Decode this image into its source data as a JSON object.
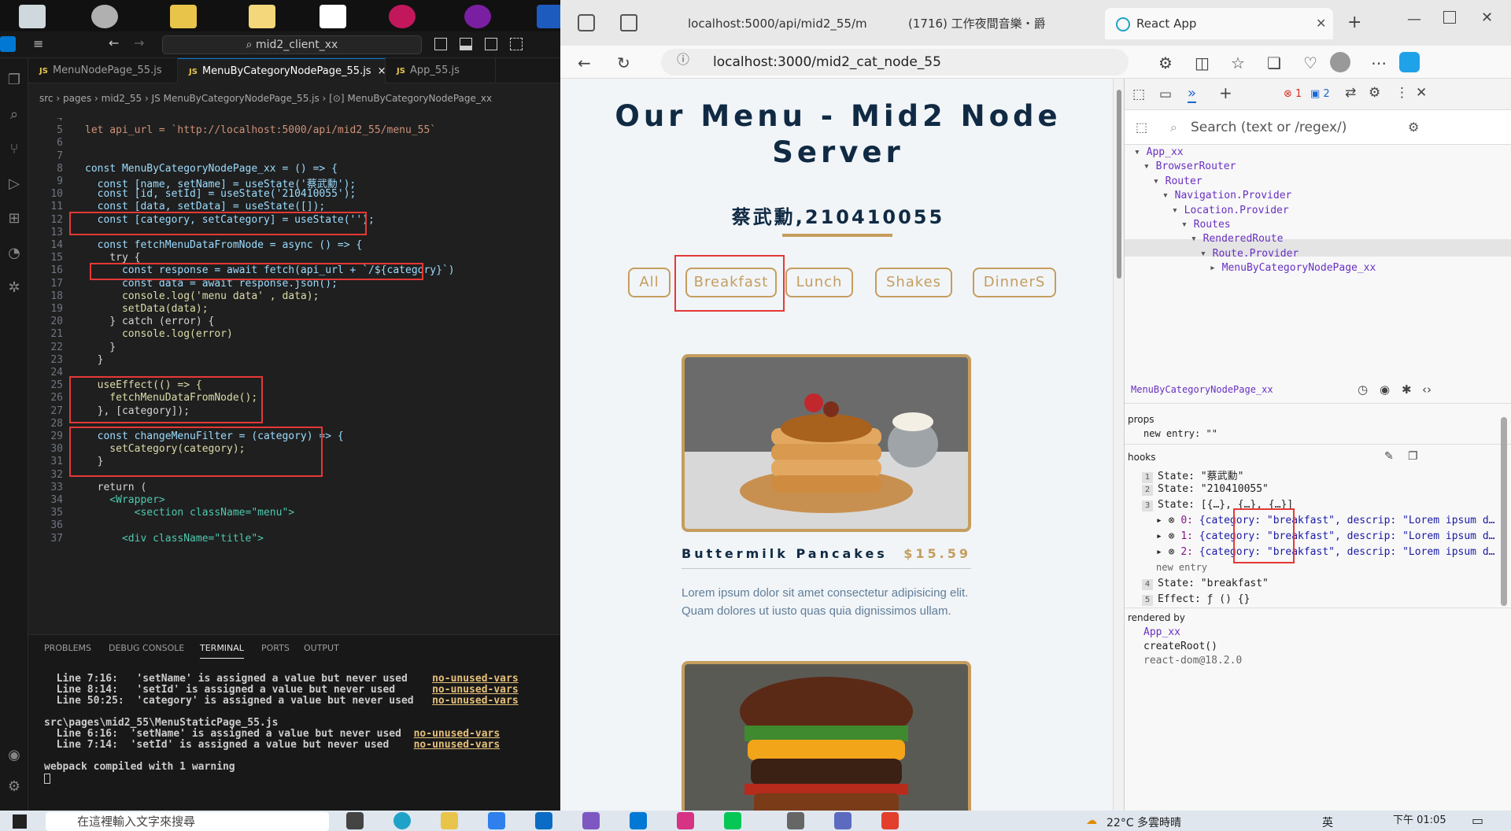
{
  "vscode": {
    "search": "mid2_client_xx",
    "tabs": [
      "MenuNodePage_55.js",
      "MenuByCategoryNodePage_55.js",
      "App_55.js"
    ],
    "tab_badge": "JS",
    "tab_close": "×",
    "breadcrumb": [
      "src",
      "pages",
      "mid2_55",
      "JS MenuByCategoryNodePage_55.js",
      "[⊙] MenuByCategoryNodePage_xx"
    ],
    "code_lines": [
      {
        "n": "4",
        "t": ""
      },
      {
        "n": "5",
        "t": "let api_url = `http://localhost:5000/api/mid2_55/menu_55`"
      },
      {
        "n": "6",
        "t": ""
      },
      {
        "n": "7",
        "t": ""
      },
      {
        "n": "8",
        "t": "const MenuByCategoryNodePage_xx = () => {"
      },
      {
        "n": "9",
        "t": "  const [name, setName] = useState('蔡武勳');"
      },
      {
        "n": "10",
        "t": "  const [id, setId] = useState('210410055');"
      },
      {
        "n": "11",
        "t": "  const [data, setData] = useState([]);"
      },
      {
        "n": "12",
        "t": "  const [category, setCategory] = useState('');"
      },
      {
        "n": "13",
        "t": ""
      },
      {
        "n": "14",
        "t": "  const fetchMenuDataFromNode = async () => {"
      },
      {
        "n": "15",
        "t": "    try {"
      },
      {
        "n": "16",
        "t": "      const response = await fetch(api_url + `/${category}`)"
      },
      {
        "n": "17",
        "t": "      const data = await response.json();"
      },
      {
        "n": "18",
        "t": "      console.log('menu data' , data);"
      },
      {
        "n": "19",
        "t": "      setData(data);"
      },
      {
        "n": "20",
        "t": "    } catch (error) {"
      },
      {
        "n": "21",
        "t": "      console.log(error)"
      },
      {
        "n": "22",
        "t": "    }"
      },
      {
        "n": "23",
        "t": "  }"
      },
      {
        "n": "24",
        "t": ""
      },
      {
        "n": "25",
        "t": "  useEffect(() => {"
      },
      {
        "n": "26",
        "t": "    fetchMenuDataFromNode();"
      },
      {
        "n": "27",
        "t": "  }, [category]);"
      },
      {
        "n": "28",
        "t": ""
      },
      {
        "n": "29",
        "t": "  const changeMenuFilter = (category) => {"
      },
      {
        "n": "30",
        "t": "    setCategory(category);"
      },
      {
        "n": "31",
        "t": "  }"
      },
      {
        "n": "32",
        "t": ""
      },
      {
        "n": "33",
        "t": "  return ("
      },
      {
        "n": "34",
        "t": "    <Wrapper>"
      },
      {
        "n": "35",
        "t": "        <section className=\"menu\">"
      },
      {
        "n": "36",
        "t": ""
      },
      {
        "n": "37",
        "t": "      <div className=\"title\">"
      }
    ],
    "panel_tabs": [
      "PROBLEMS",
      "DEBUG CONSOLE",
      "TERMINAL",
      "PORTS",
      "OUTPUT"
    ],
    "terminal": [
      {
        "pre": "  Line 7:16:   'setName' is assigned a value but never used    ",
        "warn": "no-unused-vars"
      },
      {
        "pre": "  Line 8:14:   'setId' is assigned a value but never used      ",
        "warn": "no-unused-vars"
      },
      {
        "pre": "  Line 50:25:  'category' is assigned a value but never used   ",
        "warn": "no-unused-vars"
      },
      {
        "pre": "",
        "warn": ""
      },
      {
        "pre": "src\\pages\\mid2_55\\MenuStaticPage_55.js",
        "warn": ""
      },
      {
        "pre": "  Line 6:16:  'setName' is assigned a value but never used  ",
        "warn": "no-unused-vars"
      },
      {
        "pre": "  Line 7:14:  'setId' is assigned a value but never used    ",
        "warn": "no-unused-vars"
      },
      {
        "pre": "",
        "warn": ""
      },
      {
        "pre": "webpack compiled with 1 warning",
        "warn": ""
      }
    ]
  },
  "browser": {
    "tabs": [
      "localhost:5000/api/mid2_55/m",
      "(1716) 工作夜間音樂・爵",
      "React App"
    ],
    "url": "localhost:3000/mid2_cat_node_55",
    "page": {
      "title_line1": "Our Menu - Mid2 Node",
      "title_line2": "Server",
      "name": "蔡武勳,210410055",
      "filters": [
        "All",
        "Breakfast",
        "Lunch",
        "Shakes",
        "DinnerS"
      ],
      "items": [
        {
          "name": "Buttermilk Pancakes",
          "price": "$15.59",
          "desc": "Lorem ipsum dolor sit amet consectetur adipisicing elit. Quam dolores ut iusto quas quia dignissimos ullam."
        }
      ]
    },
    "devtools": {
      "errors": "1",
      "messages": "2",
      "search_placeholder": "Search (text or /regex/)",
      "tree": [
        "App_xx",
        "BrowserRouter",
        "Router",
        "Navigation.Provider",
        "Location.Provider",
        "Routes",
        "RenderedRoute",
        "Route.Provider",
        "MenuByCategoryNodePage_xx"
      ],
      "selected": "MenuByCategoryNodePage_xx",
      "props_label": "props",
      "props_entry": "new entry: \"\"",
      "hooks_label": "hooks",
      "hooks": [
        {
          "i": "1",
          "t": "State: \"蔡武勳\""
        },
        {
          "i": "2",
          "t": "State: \"210410055\""
        },
        {
          "i": "3",
          "t": "State: [{…}, {…}, {…}]"
        }
      ],
      "hook_items": [
        {
          "i": "0:",
          "t": "{category: \"breakfast\", descrip: \"Lorem ipsum d…"
        },
        {
          "i": "1:",
          "t": "{category: \"breakfast\", descrip: \"Lorem ipsum d…"
        },
        {
          "i": "2:",
          "t": "{category: \"breakfast\", descrip: \"Lorem ipsum d…"
        }
      ],
      "new_entry": "new entry",
      "hook4": {
        "i": "4",
        "t": "State: \"breakfast\""
      },
      "hook5": {
        "i": "5",
        "t": "Effect: ƒ () {}"
      },
      "rendered_by": "rendered by",
      "rendered": [
        "App_xx",
        "createRoot()",
        "react-dom@18.2.0"
      ]
    }
  },
  "taskbar": {
    "search": "在這裡輸入文字來搜尋",
    "weather": "22°C 多雲時晴",
    "lang": "英",
    "time": "下午 01:05"
  },
  "colors": {
    "accent": "#c59d5f",
    "title": "#102a43",
    "highlight": "#e53935"
  }
}
